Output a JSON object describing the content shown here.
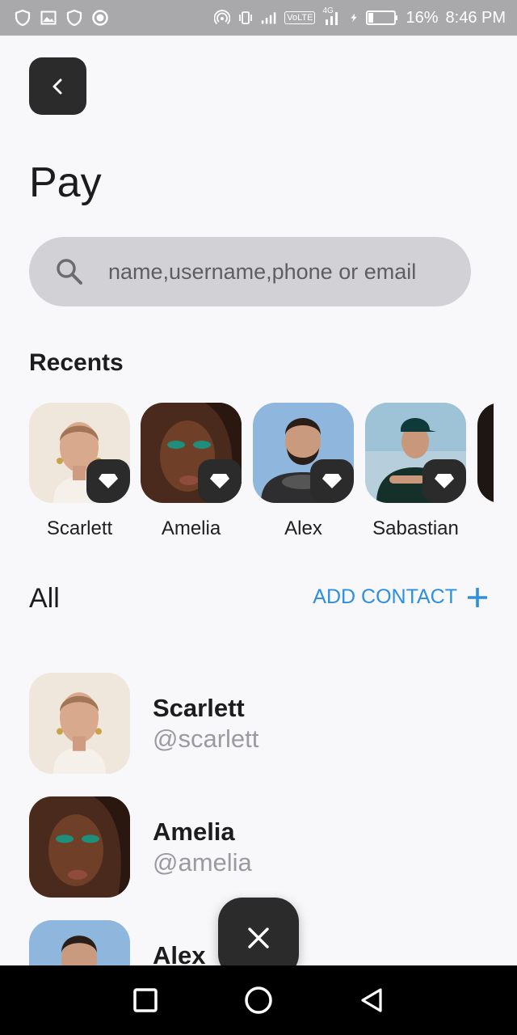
{
  "status_bar": {
    "battery_percent": "16%",
    "time": "8:46 PM",
    "network_label": "4G",
    "volte_label": "VoLTE",
    "left_icons": [
      "shield-icon",
      "image-icon",
      "shield-icon",
      "circle-icon"
    ],
    "right_icons": [
      "hotspot-icon",
      "vibrate-icon",
      "signal-icon",
      "volte-icon",
      "signal-4g-icon",
      "charging-icon",
      "battery-icon"
    ]
  },
  "header": {
    "back_icon": "chevron-left-icon",
    "title": "Pay"
  },
  "search": {
    "icon": "search-icon",
    "placeholder": "name,username,phone or email",
    "value": ""
  },
  "recents": {
    "heading": "Recents",
    "badge_icon": "diamond-icon",
    "items": [
      {
        "name": "Scarlett"
      },
      {
        "name": "Amelia"
      },
      {
        "name": "Alex"
      },
      {
        "name": "Sabastian"
      },
      {
        "name": ""
      }
    ]
  },
  "all": {
    "heading": "All",
    "add_contact_label": "ADD CONTACT",
    "add_icon": "plus-icon"
  },
  "contacts": [
    {
      "name": "Scarlett",
      "handle": "@scarlett"
    },
    {
      "name": "Amelia",
      "handle": "@amelia"
    },
    {
      "name": "Alex",
      "handle": ""
    }
  ],
  "fab": {
    "icon": "close-icon"
  },
  "nav": {
    "icons": [
      "recent-apps-icon",
      "home-icon",
      "back-icon"
    ]
  },
  "colors": {
    "accent": "#2d8fe0",
    "dark": "#2b2b2b",
    "search_bg": "#d2d2d6",
    "status_bar": "#a9a9ab",
    "background": "#f8f8fa"
  }
}
